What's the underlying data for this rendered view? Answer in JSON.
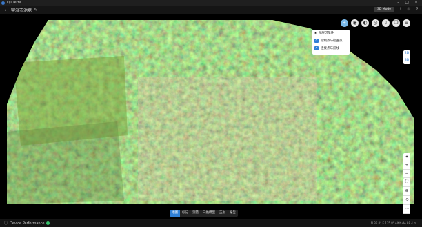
{
  "window": {
    "title": "DJI Terra"
  },
  "toolbar": {
    "project_name": "宇治市池塘",
    "mode_button": "3D Mode"
  },
  "map_tools": [
    {
      "icon": "measure-icon"
    },
    {
      "icon": "camera-icon"
    },
    {
      "icon": "brightness-icon"
    },
    {
      "icon": "globe-icon"
    },
    {
      "icon": "download-icon"
    },
    {
      "icon": "copy-icon"
    },
    {
      "icon": "layers-icon"
    }
  ],
  "layer_panel": {
    "title": "图层可见性",
    "items": [
      {
        "label": "控制点与检查点",
        "checked": true
      },
      {
        "label": "连接点与航线",
        "checked": true
      }
    ]
  },
  "zoom": {
    "label_top": "2D",
    "label_bottom": "3D"
  },
  "bottom_tabs": [
    {
      "label": "地图",
      "active": true
    },
    {
      "label": "标记"
    },
    {
      "label": "测量"
    },
    {
      "label": "三维模型"
    },
    {
      "label": "正射"
    },
    {
      "label": "报告"
    }
  ],
  "status": {
    "device_performance": "Device Performance",
    "coords": "N 35.0°  E 135.8°  Altitude 88.4 m"
  },
  "colors": {
    "accent": "#2f7fd5",
    "good": "#35c06a",
    "forest_light": "#6f9a3c",
    "forest_dark": "#2f4a1e"
  }
}
